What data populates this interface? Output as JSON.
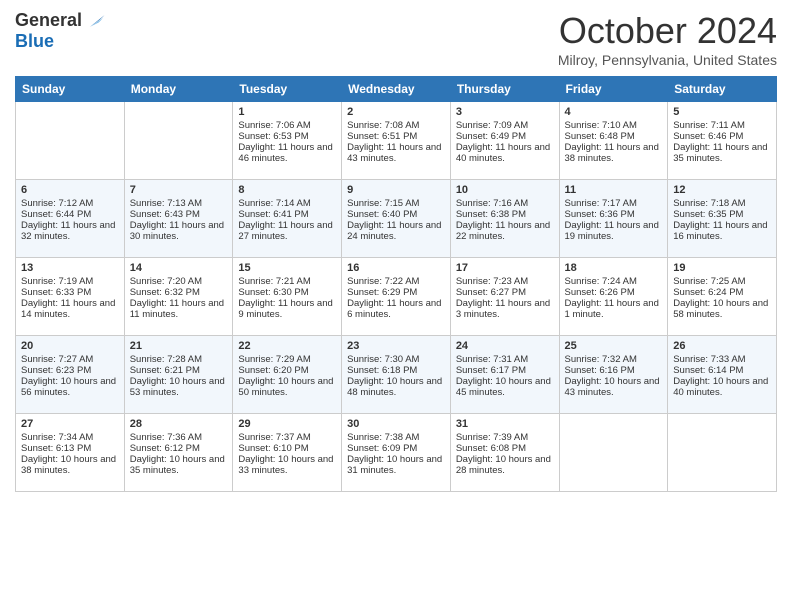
{
  "header": {
    "logo_line1": "General",
    "logo_line2": "Blue",
    "month_title": "October 2024",
    "location": "Milroy, Pennsylvania, United States"
  },
  "days_of_week": [
    "Sunday",
    "Monday",
    "Tuesday",
    "Wednesday",
    "Thursday",
    "Friday",
    "Saturday"
  ],
  "weeks": [
    [
      {
        "day": "",
        "sunrise": "",
        "sunset": "",
        "daylight": ""
      },
      {
        "day": "",
        "sunrise": "",
        "sunset": "",
        "daylight": ""
      },
      {
        "day": "1",
        "sunrise": "Sunrise: 7:06 AM",
        "sunset": "Sunset: 6:53 PM",
        "daylight": "Daylight: 11 hours and 46 minutes."
      },
      {
        "day": "2",
        "sunrise": "Sunrise: 7:08 AM",
        "sunset": "Sunset: 6:51 PM",
        "daylight": "Daylight: 11 hours and 43 minutes."
      },
      {
        "day": "3",
        "sunrise": "Sunrise: 7:09 AM",
        "sunset": "Sunset: 6:49 PM",
        "daylight": "Daylight: 11 hours and 40 minutes."
      },
      {
        "day": "4",
        "sunrise": "Sunrise: 7:10 AM",
        "sunset": "Sunset: 6:48 PM",
        "daylight": "Daylight: 11 hours and 38 minutes."
      },
      {
        "day": "5",
        "sunrise": "Sunrise: 7:11 AM",
        "sunset": "Sunset: 6:46 PM",
        "daylight": "Daylight: 11 hours and 35 minutes."
      }
    ],
    [
      {
        "day": "6",
        "sunrise": "Sunrise: 7:12 AM",
        "sunset": "Sunset: 6:44 PM",
        "daylight": "Daylight: 11 hours and 32 minutes."
      },
      {
        "day": "7",
        "sunrise": "Sunrise: 7:13 AM",
        "sunset": "Sunset: 6:43 PM",
        "daylight": "Daylight: 11 hours and 30 minutes."
      },
      {
        "day": "8",
        "sunrise": "Sunrise: 7:14 AM",
        "sunset": "Sunset: 6:41 PM",
        "daylight": "Daylight: 11 hours and 27 minutes."
      },
      {
        "day": "9",
        "sunrise": "Sunrise: 7:15 AM",
        "sunset": "Sunset: 6:40 PM",
        "daylight": "Daylight: 11 hours and 24 minutes."
      },
      {
        "day": "10",
        "sunrise": "Sunrise: 7:16 AM",
        "sunset": "Sunset: 6:38 PM",
        "daylight": "Daylight: 11 hours and 22 minutes."
      },
      {
        "day": "11",
        "sunrise": "Sunrise: 7:17 AM",
        "sunset": "Sunset: 6:36 PM",
        "daylight": "Daylight: 11 hours and 19 minutes."
      },
      {
        "day": "12",
        "sunrise": "Sunrise: 7:18 AM",
        "sunset": "Sunset: 6:35 PM",
        "daylight": "Daylight: 11 hours and 16 minutes."
      }
    ],
    [
      {
        "day": "13",
        "sunrise": "Sunrise: 7:19 AM",
        "sunset": "Sunset: 6:33 PM",
        "daylight": "Daylight: 11 hours and 14 minutes."
      },
      {
        "day": "14",
        "sunrise": "Sunrise: 7:20 AM",
        "sunset": "Sunset: 6:32 PM",
        "daylight": "Daylight: 11 hours and 11 minutes."
      },
      {
        "day": "15",
        "sunrise": "Sunrise: 7:21 AM",
        "sunset": "Sunset: 6:30 PM",
        "daylight": "Daylight: 11 hours and 9 minutes."
      },
      {
        "day": "16",
        "sunrise": "Sunrise: 7:22 AM",
        "sunset": "Sunset: 6:29 PM",
        "daylight": "Daylight: 11 hours and 6 minutes."
      },
      {
        "day": "17",
        "sunrise": "Sunrise: 7:23 AM",
        "sunset": "Sunset: 6:27 PM",
        "daylight": "Daylight: 11 hours and 3 minutes."
      },
      {
        "day": "18",
        "sunrise": "Sunrise: 7:24 AM",
        "sunset": "Sunset: 6:26 PM",
        "daylight": "Daylight: 11 hours and 1 minute."
      },
      {
        "day": "19",
        "sunrise": "Sunrise: 7:25 AM",
        "sunset": "Sunset: 6:24 PM",
        "daylight": "Daylight: 10 hours and 58 minutes."
      }
    ],
    [
      {
        "day": "20",
        "sunrise": "Sunrise: 7:27 AM",
        "sunset": "Sunset: 6:23 PM",
        "daylight": "Daylight: 10 hours and 56 minutes."
      },
      {
        "day": "21",
        "sunrise": "Sunrise: 7:28 AM",
        "sunset": "Sunset: 6:21 PM",
        "daylight": "Daylight: 10 hours and 53 minutes."
      },
      {
        "day": "22",
        "sunrise": "Sunrise: 7:29 AM",
        "sunset": "Sunset: 6:20 PM",
        "daylight": "Daylight: 10 hours and 50 minutes."
      },
      {
        "day": "23",
        "sunrise": "Sunrise: 7:30 AM",
        "sunset": "Sunset: 6:18 PM",
        "daylight": "Daylight: 10 hours and 48 minutes."
      },
      {
        "day": "24",
        "sunrise": "Sunrise: 7:31 AM",
        "sunset": "Sunset: 6:17 PM",
        "daylight": "Daylight: 10 hours and 45 minutes."
      },
      {
        "day": "25",
        "sunrise": "Sunrise: 7:32 AM",
        "sunset": "Sunset: 6:16 PM",
        "daylight": "Daylight: 10 hours and 43 minutes."
      },
      {
        "day": "26",
        "sunrise": "Sunrise: 7:33 AM",
        "sunset": "Sunset: 6:14 PM",
        "daylight": "Daylight: 10 hours and 40 minutes."
      }
    ],
    [
      {
        "day": "27",
        "sunrise": "Sunrise: 7:34 AM",
        "sunset": "Sunset: 6:13 PM",
        "daylight": "Daylight: 10 hours and 38 minutes."
      },
      {
        "day": "28",
        "sunrise": "Sunrise: 7:36 AM",
        "sunset": "Sunset: 6:12 PM",
        "daylight": "Daylight: 10 hours and 35 minutes."
      },
      {
        "day": "29",
        "sunrise": "Sunrise: 7:37 AM",
        "sunset": "Sunset: 6:10 PM",
        "daylight": "Daylight: 10 hours and 33 minutes."
      },
      {
        "day": "30",
        "sunrise": "Sunrise: 7:38 AM",
        "sunset": "Sunset: 6:09 PM",
        "daylight": "Daylight: 10 hours and 31 minutes."
      },
      {
        "day": "31",
        "sunrise": "Sunrise: 7:39 AM",
        "sunset": "Sunset: 6:08 PM",
        "daylight": "Daylight: 10 hours and 28 minutes."
      },
      {
        "day": "",
        "sunrise": "",
        "sunset": "",
        "daylight": ""
      },
      {
        "day": "",
        "sunrise": "",
        "sunset": "",
        "daylight": ""
      }
    ]
  ]
}
